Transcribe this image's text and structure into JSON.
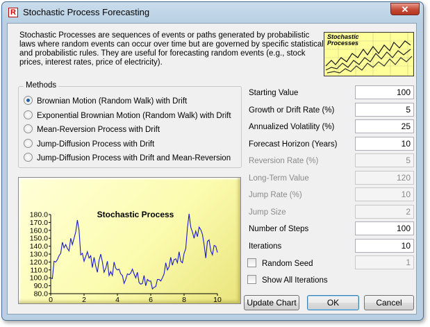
{
  "window": {
    "title": "Stochastic Process Forecasting",
    "app_icon_letter": "R",
    "close_glyph": "✕"
  },
  "description": "Stochastic Processes are sequences of events or paths generated by probabilistic laws where random events can occur over time but are governed by specific statistical and probabilistic rules. They are useful for forecasting random events (e.g., stock prices, interest rates, price of electricity).",
  "thumbnail": {
    "title_line1": "Stochastic",
    "title_line2": "Processes"
  },
  "methods": {
    "legend": "Methods",
    "selected_index": 0,
    "items": [
      "Brownian Motion (Random Walk) with Drift",
      "Exponential Brownian Motion (Random Walk) with Drift",
      "Mean-Reversion Process with Drift",
      "Jump-Diffusion Process with Drift",
      "Jump-Diffusion Process with Drift and Mean-Reversion"
    ]
  },
  "params": [
    {
      "label": "Starting Value",
      "value": "100",
      "enabled": true
    },
    {
      "label": "Growth or Drift Rate (%)",
      "value": "5",
      "enabled": true
    },
    {
      "label": "Annualized Volatility (%)",
      "value": "25",
      "enabled": true
    },
    {
      "label": "Forecast Horizon (Years)",
      "value": "10",
      "enabled": true
    },
    {
      "label": "Reversion Rate (%)",
      "value": "5",
      "enabled": false
    },
    {
      "label": "Long-Term Value",
      "value": "120",
      "enabled": false
    },
    {
      "label": "Jump Rate (%)",
      "value": "10",
      "enabled": false
    },
    {
      "label": "Jump Size",
      "value": "2",
      "enabled": false
    },
    {
      "label": "Number of Steps",
      "value": "100",
      "enabled": true
    },
    {
      "label": "Iterations",
      "value": "10",
      "enabled": true
    }
  ],
  "checkboxes": {
    "random_seed": {
      "label": "Random Seed",
      "checked": false,
      "value": "1"
    },
    "show_all": {
      "label": "Show All Iterations",
      "checked": false
    }
  },
  "buttons": {
    "update": "Update Chart",
    "ok": "OK",
    "cancel": "Cancel"
  },
  "colors": {
    "line": "#1a1ad0",
    "chart_bg": "#fcfcb0",
    "accent": "#3c7fb1"
  },
  "chart_data": {
    "type": "line",
    "title": "Stochastic Process",
    "xlim": [
      0,
      10
    ],
    "ylim": [
      80,
      180
    ],
    "xticks": [
      "0",
      "2",
      "4",
      "6",
      "8",
      "10"
    ],
    "yticks": [
      "80.0",
      "90.0",
      "100.0",
      "110.0",
      "120.0",
      "130.0",
      "140.0",
      "150.0",
      "160.0",
      "170.0",
      "180.0"
    ],
    "series": [
      {
        "x": [
          0,
          0.1,
          0.2,
          0.3,
          0.4,
          0.5,
          0.6,
          0.7,
          0.8,
          0.9,
          1.0,
          1.1,
          1.2,
          1.3,
          1.4,
          1.5,
          1.6,
          1.7,
          1.8,
          1.9,
          2.0,
          2.1,
          2.2,
          2.3,
          2.4,
          2.5,
          2.6,
          2.7,
          2.8,
          2.9,
          3.0,
          3.1,
          3.2,
          3.3,
          3.4,
          3.5,
          3.6,
          3.7,
          3.8,
          3.9,
          4.0,
          4.1,
          4.2,
          4.3,
          4.4,
          4.5,
          4.6,
          4.7,
          4.8,
          4.9,
          5.0,
          5.1,
          5.2,
          5.3,
          5.4,
          5.5,
          5.6,
          5.7,
          5.8,
          5.9,
          6.0,
          6.1,
          6.2,
          6.3,
          6.4,
          6.5,
          6.6,
          6.7,
          6.8,
          6.9,
          7.0,
          7.1,
          7.2,
          7.3,
          7.4,
          7.5,
          7.6,
          7.7,
          7.8,
          7.9,
          8.0,
          8.1,
          8.2,
          8.3,
          8.4,
          8.5,
          8.6,
          8.7,
          8.8,
          8.9,
          9.0,
          9.1,
          9.2,
          9.3,
          9.4,
          9.5,
          9.6,
          9.7,
          9.8,
          9.9,
          10.0
        ],
        "y": [
          100,
          99,
          121,
          120,
          123,
          128,
          131,
          145,
          138,
          142,
          137,
          134,
          150,
          142,
          150,
          158,
          173,
          160,
          129,
          131,
          121,
          127,
          133,
          125,
          128,
          113,
          126,
          115,
          107,
          122,
          130,
          120,
          107,
          112,
          121,
          103,
          108,
          103,
          120,
          112,
          110,
          111,
          105,
          103,
          93,
          98,
          105,
          104,
          106,
          111,
          105,
          100,
          107,
          94,
          92,
          93,
          103,
          90,
          98,
          96,
          96,
          86,
          88,
          89,
          98,
          98,
          96,
          100,
          105,
          119,
          110,
          114,
          126,
          116,
          123,
          124,
          119,
          133,
          121,
          119,
          131,
          137,
          163,
          181,
          164,
          158,
          150,
          159,
          152,
          164,
          161,
          155,
          142,
          125,
          146,
          148,
          134,
          129,
          141,
          140,
          132
        ]
      }
    ]
  }
}
